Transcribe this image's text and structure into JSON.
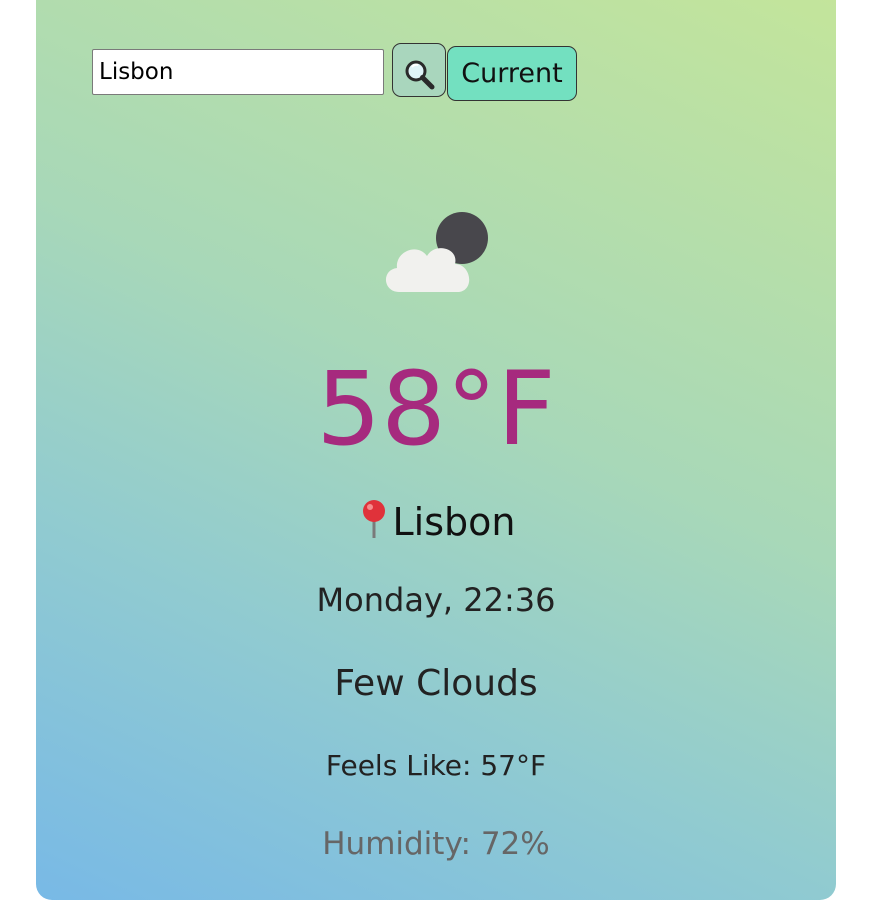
{
  "search": {
    "value": "Lisbon",
    "search_icon": "magnifier-icon",
    "current_label": "Current"
  },
  "weather": {
    "icon": "partly-cloudy-night-icon",
    "temperature": "58°F",
    "city": "Lisbon",
    "location_icon": "pin-icon",
    "datetime": "Monday, 22:36",
    "description": "Few Clouds",
    "feels_like": "Feels Like: 57°F",
    "humidity": "Humidity: 72%"
  },
  "colors": {
    "temperature": "#a62a7e",
    "current_button": "#73e0c0",
    "gradient_top": "#c4e59a",
    "gradient_bottom": "#78b9e6"
  }
}
